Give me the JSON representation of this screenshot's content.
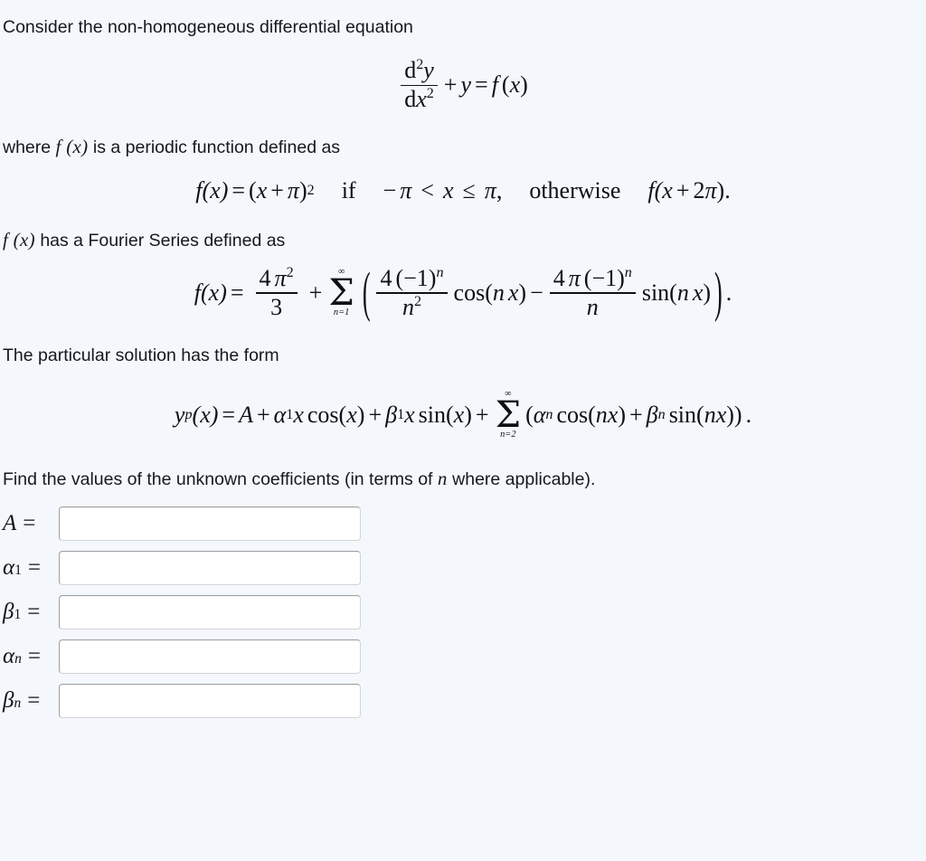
{
  "page": {
    "background_color": "#f4f7fc",
    "text_color": "#16181c"
  },
  "intro": {
    "line1": "Consider the non-homogeneous differential equation"
  },
  "equation_ode": {
    "num_d": "d",
    "num_exp": "2",
    "num_y": "y",
    "den_d": "d",
    "den_x": "x",
    "den_exp": "2",
    "plus": "+",
    "y": "y",
    "equals": "=",
    "f": "f",
    "open": "(",
    "x": "x",
    "close": ")"
  },
  "where_line": {
    "before": "where",
    "inline_math": "f (x)",
    "after": "is a periodic function defined as"
  },
  "equation_piecewise": {
    "f": "f",
    "of_x": "(x)",
    "equals": "=",
    "open": "(",
    "x": "x",
    "plus": "+",
    "pi": "π",
    "close": ")",
    "sq": "2",
    "if": "if",
    "minus": "−",
    "pi2": "π",
    "lt": "<",
    "x2": "x",
    "le": "≤",
    "pi3": "π",
    "comma": ",",
    "otherwise": "otherwise",
    "f2": "f",
    "of_x2": "(x",
    "plus2": "+",
    "two": "2",
    "pi4": "π",
    "close2": ")",
    "period": "."
  },
  "fourier_line": {
    "inline_math": "f (x)",
    "text": "has a Fourier Series defined as"
  },
  "equation_fourier": {
    "f": "f",
    "of_x": "(x)",
    "equals": "=",
    "a0_num_4": "4",
    "a0_num_pi": "π",
    "a0_num_exp": "2",
    "a0_den": "3",
    "plus": "+",
    "sum_upper": "∞",
    "sum_sigma": "Σ",
    "sum_lower": "n=1",
    "paren_open": "(",
    "an_num_4": "4",
    "an_num_paren": "(−1)",
    "an_num_exp": "n",
    "an_den_n": "n",
    "an_den_exp": "2",
    "cos": "cos(",
    "cos_n": "n",
    "cos_x": "x",
    "cos_close": ")",
    "minus": "−",
    "bn_num_4": "4",
    "bn_num_pi": "π",
    "bn_num_paren": "(−1)",
    "bn_num_exp": "n",
    "bn_den_n": "n",
    "sin": "sin(",
    "sin_n": "n",
    "sin_x": "x",
    "sin_close": ")",
    "paren_close": ")",
    "period": "."
  },
  "particular_line": {
    "text": "The particular solution has the form"
  },
  "equation_particular": {
    "y": "y",
    "p": "p",
    "of_x": "(x)",
    "equals": "=",
    "A": "A",
    "plus1": "+",
    "alpha1": "α",
    "alpha1_sub": "1",
    "x1": "x",
    "cos1": "cos(",
    "x1b": "x",
    "cos1_close": ")",
    "plus2": "+",
    "beta1": "β",
    "beta1_sub": "1",
    "x2": "x",
    "sin1": "sin(",
    "x2b": "x",
    "sin1_close": ")",
    "plus3": "+",
    "sum_upper": "∞",
    "sum_sigma": "Σ",
    "sum_lower": "n=2",
    "paren_open": "(",
    "alphan": "α",
    "alphan_sub": "n",
    "cos2": "cos(",
    "cos2_n": "n",
    "cos2_x": "x",
    "cos2_close": ")",
    "plus4": "+",
    "betan": "β",
    "betan_sub": "n",
    "sin2": "sin(",
    "sin2_n": "n",
    "sin2_x": "x",
    "sin2_close": ")",
    "paren_close": ")",
    "period": "."
  },
  "instruction": {
    "before": "Find the values of the unknown coefficients (in terms of",
    "inline_math": "n",
    "after": "where applicable)."
  },
  "answer_fields": [
    {
      "symbol": "A",
      "subscript": "",
      "equals": "=",
      "value": "",
      "placeholder": ""
    },
    {
      "symbol": "α",
      "subscript": "1",
      "equals": "=",
      "value": "",
      "placeholder": ""
    },
    {
      "symbol": "β",
      "subscript": "1",
      "equals": "=",
      "value": "",
      "placeholder": ""
    },
    {
      "symbol": "α",
      "subscript": "n",
      "equals": "=",
      "value": "",
      "placeholder": ""
    },
    {
      "symbol": "β",
      "subscript": "n",
      "equals": "=",
      "value": "",
      "placeholder": ""
    }
  ]
}
